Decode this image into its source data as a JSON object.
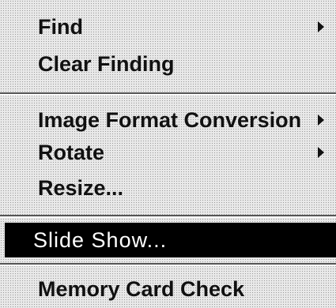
{
  "context_menu": {
    "items": [
      {
        "label": "Find",
        "submenu_arrow": "right-triangle-icon"
      },
      {
        "label": "Clear Finding"
      },
      {
        "label": "Image Format Conversion",
        "submenu_arrow": "right-triangle-icon"
      },
      {
        "label": "Rotate",
        "submenu_arrow": "right-triangle-icon"
      },
      {
        "label": "Resize..."
      },
      {
        "label": "Slide Show...",
        "highlighted": true
      },
      {
        "label": "Memory Card Check"
      }
    ],
    "colors": {
      "highlight_background": "#000000",
      "highlight_text": "#ffffff",
      "text": "#111111",
      "background": "#e9e9e9"
    }
  }
}
